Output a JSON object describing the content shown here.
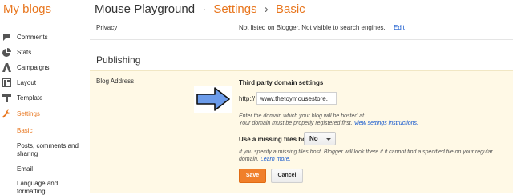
{
  "header": {
    "brand": "My blogs",
    "blog_name": "Mouse Playground",
    "sep1": "·",
    "section": "Settings",
    "sep2": "›",
    "subsection": "Basic"
  },
  "sidebar": {
    "items": [
      {
        "label": "Comments",
        "icon": "comments-icon"
      },
      {
        "label": "Stats",
        "icon": "stats-icon"
      },
      {
        "label": "Campaigns",
        "icon": "campaigns-icon"
      },
      {
        "label": "Layout",
        "icon": "layout-icon"
      },
      {
        "label": "Template",
        "icon": "template-icon"
      },
      {
        "label": "Settings",
        "icon": "wrench-icon"
      }
    ],
    "sub_items": [
      {
        "label": "Basic"
      },
      {
        "label": "Posts, comments and sharing"
      },
      {
        "label": "Email"
      },
      {
        "label": "Language and formatting"
      }
    ]
  },
  "privacy": {
    "label": "Privacy",
    "value": "Not listed on Blogger. Not visible to search engines.",
    "edit": "Edit"
  },
  "publishing": {
    "title": "Publishing",
    "address_label": "Blog Address",
    "third_party_title": "Third party domain settings",
    "http_prefix": "http://",
    "domain_value": "www.thetoymousestore.",
    "help1_line1": "Enter the domain which your blog will be hosted at.",
    "help1_line2": "Your domain must be properly registered first.",
    "help1_link": "View settings instructions.",
    "missing_files_title": "Use a missing files host?",
    "missing_files_value": "No",
    "help2_text": "If you specify a missing files host, Blogger will look there if it cannot find a specified file on your regular domain.",
    "help2_link": "Learn more.",
    "save_label": "Save",
    "cancel_label": "Cancel"
  },
  "colors": {
    "accent": "#e8761e",
    "link": "#1155cc",
    "panel": "#fff9e6",
    "arrow": "#6b9bea"
  }
}
